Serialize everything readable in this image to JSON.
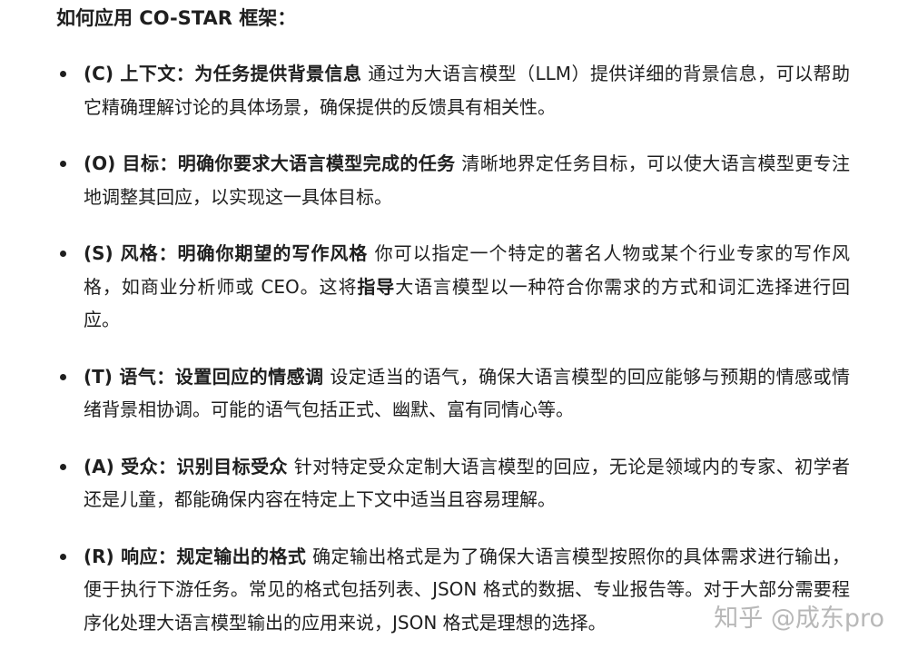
{
  "heading": "如何应用 CO-STAR 框架：",
  "items": [
    {
      "label": "(C) 上下文：为任务提供背景信息",
      "text": " 通过为大语言模型（LLM）提供详细的背景信息，可以帮助它精确理解讨论的具体场景，确保提供的反馈具有相关性。"
    },
    {
      "label": "(O) 目标：明确你要求大语言模型完成的任务",
      "text": " 清晰地界定任务目标，可以使大语言模型更专注地调整其回应，以实现这一具体目标。"
    },
    {
      "label": "(S) 风格：明确你期望的写作风格",
      "text_before": " 你可以指定一个特定的著名人物或某个行业专家的写作风格，如商业分析师或 CEO。这将",
      "text_bold": "指导",
      "text_after": "大语言模型以一种符合你需求的方式和词汇选择进行回应。"
    },
    {
      "label": "(T) 语气：设置回应的情感调",
      "text": " 设定适当的语气，确保大语言模型的回应能够与预期的情感或情绪背景相协调。可能的语气包括正式、幽默、富有同情心等。"
    },
    {
      "label": "(A) 受众：识别目标受众",
      "text": " 针对特定受众定制大语言模型的回应，无论是领域内的专家、初学者还是儿童，都能确保内容在特定上下文中适当且容易理解。"
    },
    {
      "label": "(R) 响应：规定输出的格式",
      "text": " 确定输出格式是为了确保大语言模型按照你的具体需求进行输出，便于执行下游任务。常见的格式包括列表、JSON 格式的数据、专业报告等。对于大部分需要程序化处理大语言模型输出的应用来说，JSON 格式是理想的选择。"
    }
  ],
  "watermark": "知乎 @成东pro"
}
